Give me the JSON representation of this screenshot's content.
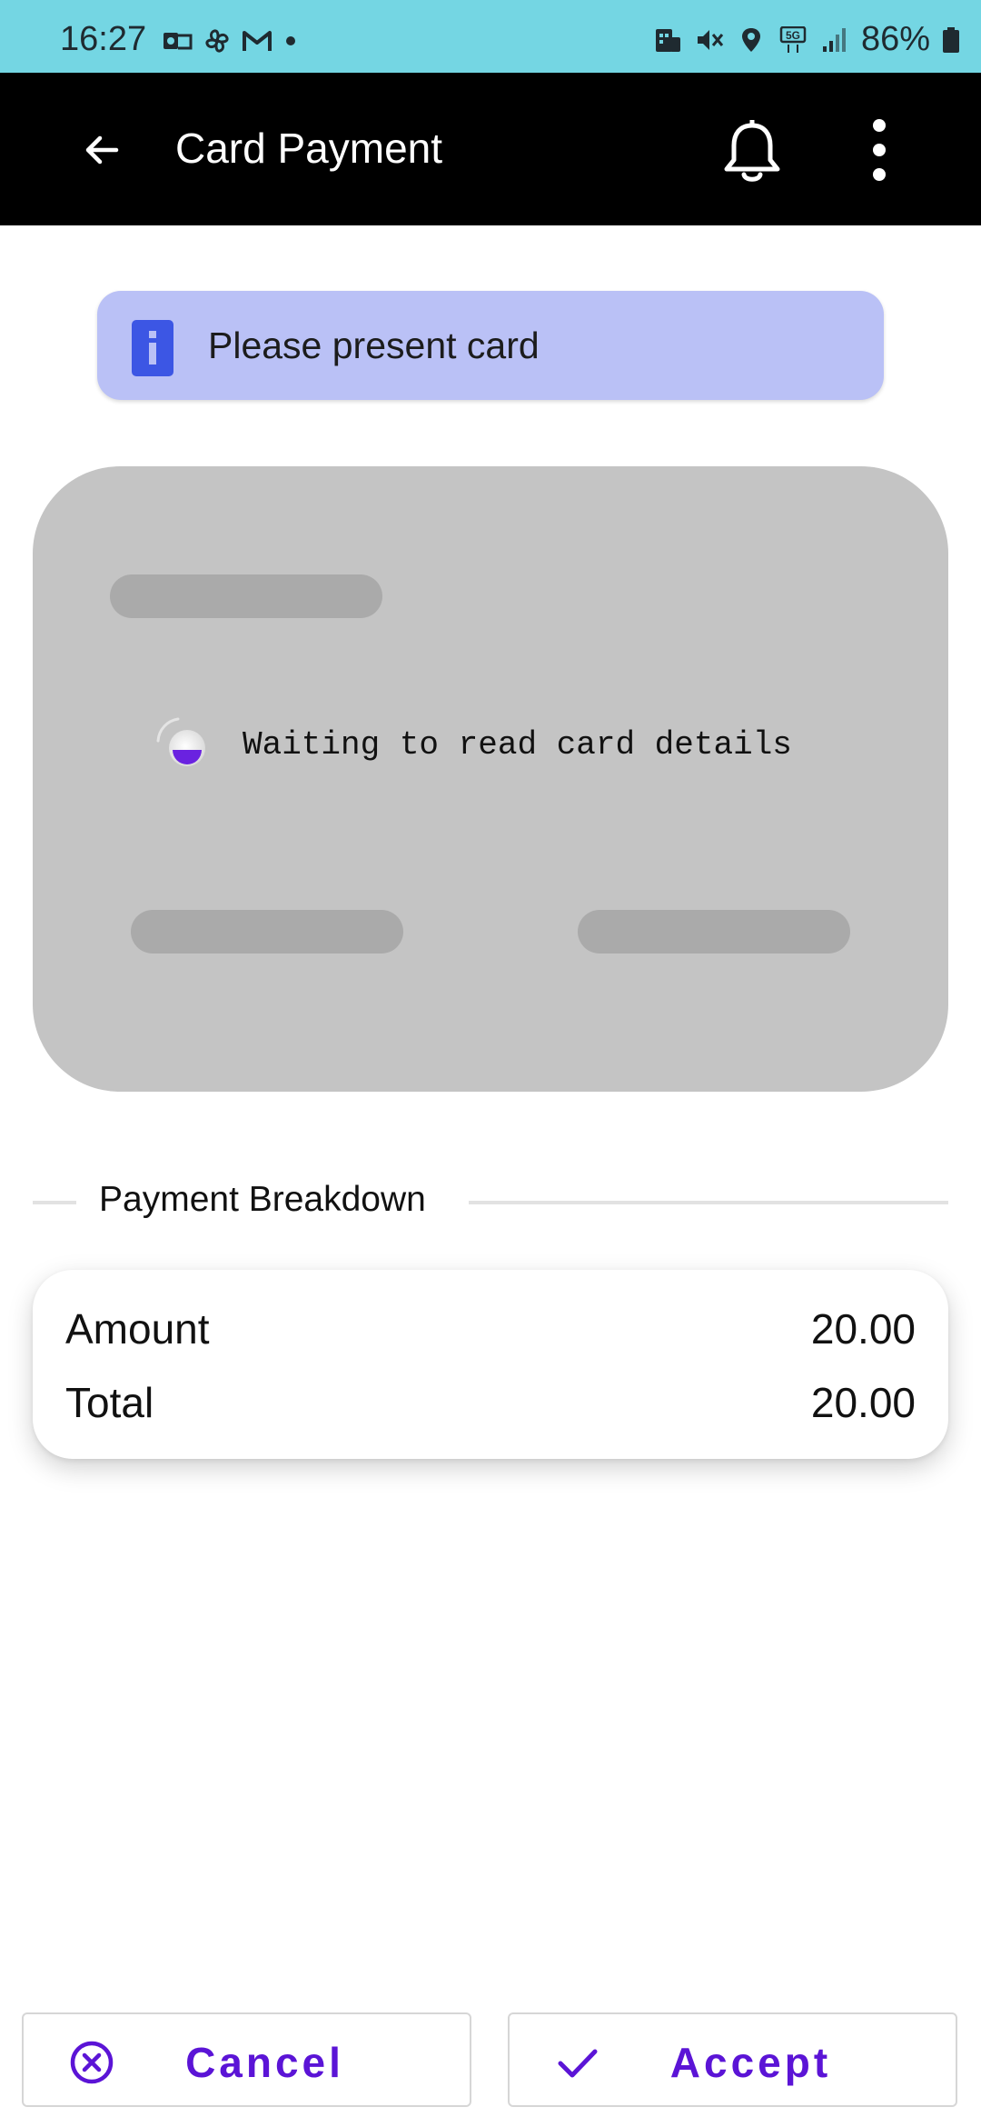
{
  "status_bar": {
    "time": "16:27",
    "battery": "86%",
    "left_icons": [
      "outlook-icon",
      "pinwheel-icon",
      "gmail-icon",
      "dot-icon"
    ],
    "right_icons": [
      "building-icon",
      "mute-icon",
      "location-icon",
      "5g-icon",
      "signal-icon",
      "battery-icon"
    ]
  },
  "app_bar": {
    "title": "Card Payment",
    "back_icon": "arrow-back-icon",
    "bell_icon": "bell-icon",
    "more_icon": "more-vert-icon"
  },
  "info_banner": {
    "text": "Please present card",
    "icon": "info-icon"
  },
  "card_reader": {
    "status_text": "Waiting to read card details"
  },
  "breakdown": {
    "title": "Payment Breakdown",
    "rows": [
      {
        "label": "Amount",
        "value": "20.00"
      },
      {
        "label": "Total",
        "value": "20.00"
      }
    ]
  },
  "actions": {
    "cancel_label": "Cancel",
    "accept_label": "Accept"
  },
  "colors": {
    "status_bar": "#74d6e3",
    "app_bar": "#000000",
    "banner": "#bac1f6",
    "info_icon": "#3c56e4",
    "card": "#c4c4c4",
    "accent": "#5b14d6"
  }
}
